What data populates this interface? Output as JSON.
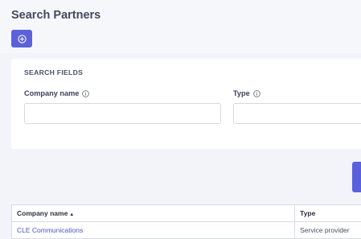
{
  "header": {
    "title": "Search Partners",
    "add_icon": "plus-circle-icon"
  },
  "search": {
    "heading": "SEARCH FIELDS",
    "fields": [
      {
        "label": "Company name",
        "value": "",
        "placeholder": ""
      },
      {
        "label": "Type",
        "value": "",
        "placeholder": ""
      }
    ]
  },
  "table": {
    "columns": [
      {
        "label": "Company name",
        "sort": "▲"
      },
      {
        "label": "Type"
      }
    ],
    "rows": [
      {
        "company": "CLE Communications",
        "type": "Service provider"
      }
    ]
  },
  "colors": {
    "accent": "#5b61d8",
    "link": "#4b53c8"
  }
}
